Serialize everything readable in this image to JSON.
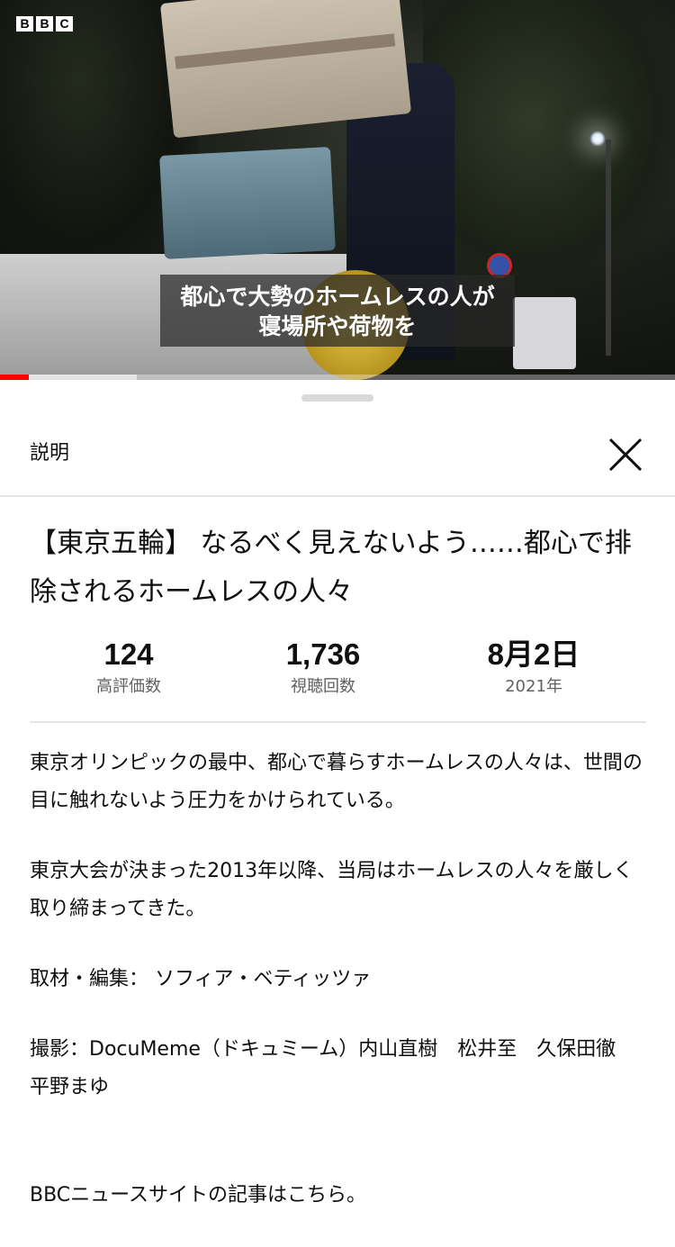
{
  "video": {
    "logo": [
      "B",
      "B",
      "C"
    ],
    "subtitle_line1": "都心で大勢のホームレスの人が",
    "subtitle_line2": "寝場所や荷物を",
    "progress_fraction": 0.043,
    "buffered_fraction": 0.203,
    "progress_color": "#ff0000"
  },
  "sheet": {
    "title": "説明",
    "close_icon": "close-icon"
  },
  "details": {
    "title": "【東京五輪】 なるべく見えないよう……都心で排除されるホームレスの人々",
    "stats": [
      {
        "value": "124",
        "label": "高評価数"
      },
      {
        "value": "1,736",
        "label": "視聴回数"
      },
      {
        "value": "8月2日",
        "label": "2021年"
      }
    ],
    "description": [
      "東京オリンピックの最中、都心で暮らすホームレスの人々は、世間の目に触れないよう圧力をかけられている。",
      "東京大会が決まった2013年以降、当局はホームレスの人々を厳しく取り締まってきた。",
      "取材・編集： ソフィア・ベティッツァ",
      "撮影：DocuMeme（ドキュミーム）内山直樹　松井至　久保田徹　平野まゆ",
      "BBCニュースサイトの記事はこちら。"
    ]
  }
}
